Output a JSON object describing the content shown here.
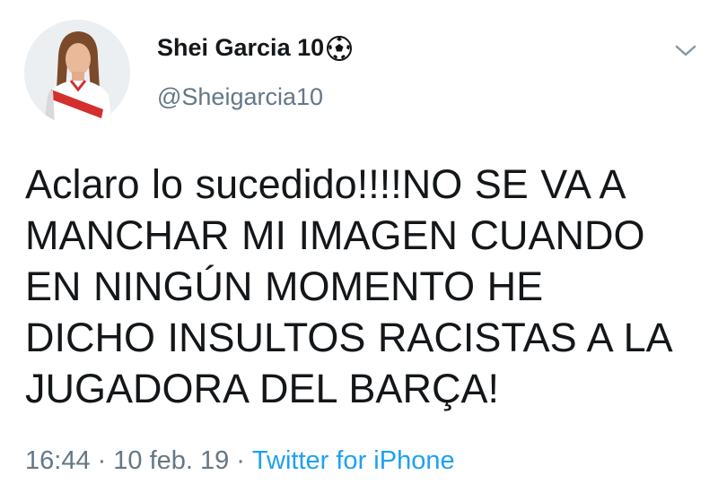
{
  "tweet": {
    "author": {
      "display_name": "Shei Garcia 10",
      "name_emoji_icon": "soccer-ball-icon",
      "handle": "@Sheigarcia10"
    },
    "text_lines": [
      "Aclaro lo sucedido!!!!NO SE VA A",
      "MANCHAR MI IMAGEN CUANDO",
      "EN NINGÚN MOMENTO HE",
      "DICHO INSULTOS RACISTAS A LA",
      "JUGADORA DEL BARÇA!"
    ],
    "time": "16:44",
    "date": "10 feb. 19",
    "separator": "·",
    "source": "Twitter for iPhone",
    "menu_icon": "chevron-down-icon"
  },
  "colors": {
    "text": "#14171a",
    "secondary": "#657786",
    "link": "#1da1f2"
  }
}
